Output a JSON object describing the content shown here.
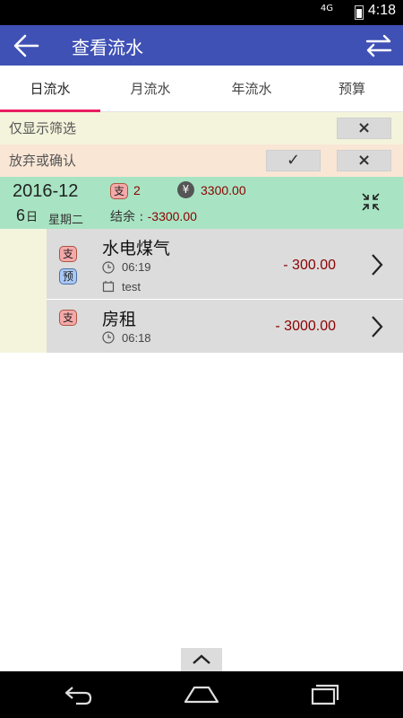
{
  "status_bar": {
    "network": "4G",
    "time": "4:18"
  },
  "app_bar": {
    "title": "查看流水",
    "back_icon": "arrow-left-icon",
    "swap_icon": "swap-arrows-icon",
    "color": "#3f51b5"
  },
  "tabs": [
    {
      "label": "日流水",
      "active": true
    },
    {
      "label": "月流水",
      "active": false
    },
    {
      "label": "年流水",
      "active": false
    },
    {
      "label": "预算",
      "active": false
    }
  ],
  "tab_indicator_color": "#e91e63",
  "filter_bar": {
    "show_filtered_label": "仅显示筛选",
    "confirm_label": "放弃或确认",
    "close_icon": "×",
    "check_icon": "✓"
  },
  "day_summary": {
    "year_month": "2016-12",
    "day": "6",
    "day_suffix": "日",
    "weekday": "星期二",
    "expense_tag": "支",
    "count": "2",
    "currency_icon": "¥",
    "total": "3300.00",
    "balance_label": "结余 : ",
    "balance_value": "-3300.00"
  },
  "entries": [
    {
      "tags": [
        "支",
        "预"
      ],
      "name": "水电煤气",
      "time": "06:19",
      "note": "test",
      "amount": "- 300.00"
    },
    {
      "tags": [
        "支"
      ],
      "name": "房租",
      "time": "06:18",
      "amount": "- 3000.00"
    }
  ]
}
